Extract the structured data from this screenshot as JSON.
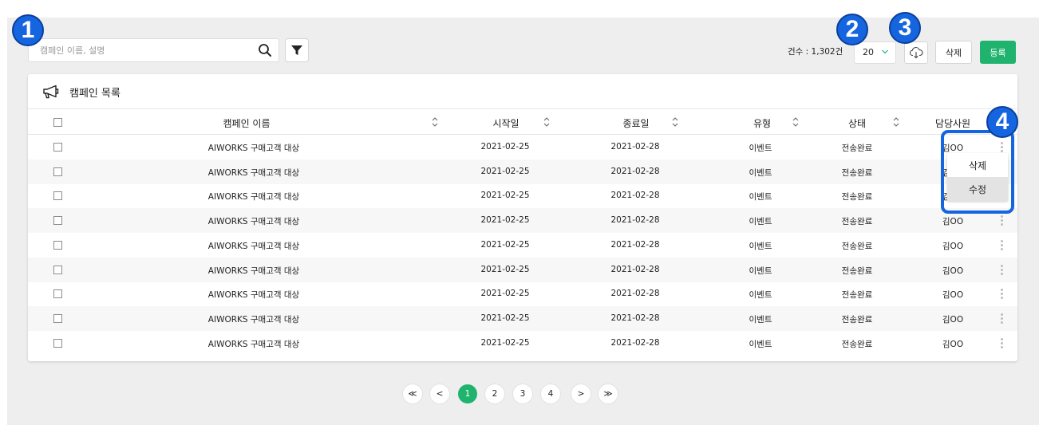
{
  "search": {
    "placeholder": "캠페인 이름, 설명"
  },
  "toolbar": {
    "count_text": "건수 : 1,302건",
    "page_size": "20",
    "delete_label": "삭제",
    "register_label": "등록"
  },
  "badges": [
    "1",
    "2",
    "3",
    "4"
  ],
  "card": {
    "title": "캠페인 목록"
  },
  "table": {
    "columns": [
      "캠페인 이름",
      "시작일",
      "종료일",
      "유형",
      "상태",
      "담당사원"
    ],
    "rows": [
      {
        "name": "AIWORKS 구매고객 대상",
        "start": "2021-02-25",
        "end": "2021-02-28",
        "type": "이벤트",
        "status": "전송완료",
        "owner": "김OO"
      },
      {
        "name": "AIWORKS 구매고객 대상",
        "start": "2021-02-25",
        "end": "2021-02-28",
        "type": "이벤트",
        "status": "전송완료",
        "owner": "김OO"
      },
      {
        "name": "AIWORKS 구매고객 대상",
        "start": "2021-02-25",
        "end": "2021-02-28",
        "type": "이벤트",
        "status": "전송완료",
        "owner": "김OO"
      },
      {
        "name": "AIWORKS 구매고객 대상",
        "start": "2021-02-25",
        "end": "2021-02-28",
        "type": "이벤트",
        "status": "전송완료",
        "owner": "김OO"
      },
      {
        "name": "AIWORKS 구매고객 대상",
        "start": "2021-02-25",
        "end": "2021-02-28",
        "type": "이벤트",
        "status": "전송완료",
        "owner": "김OO"
      },
      {
        "name": "AIWORKS 구매고객 대상",
        "start": "2021-02-25",
        "end": "2021-02-28",
        "type": "이벤트",
        "status": "전송완료",
        "owner": "김OO"
      },
      {
        "name": "AIWORKS 구매고객 대상",
        "start": "2021-02-25",
        "end": "2021-02-28",
        "type": "이벤트",
        "status": "전송완료",
        "owner": "김OO"
      },
      {
        "name": "AIWORKS 구매고객 대상",
        "start": "2021-02-25",
        "end": "2021-02-28",
        "type": "이벤트",
        "status": "전송완료",
        "owner": "김OO"
      },
      {
        "name": "AIWORKS 구매고객 대상",
        "start": "2021-02-25",
        "end": "2021-02-28",
        "type": "이벤트",
        "status": "전송완료",
        "owner": "김OO"
      }
    ]
  },
  "context_menu": {
    "items": [
      "삭제",
      "수정"
    ],
    "highlighted": "수정"
  },
  "pagination": {
    "first": "≪",
    "prev": "<",
    "pages": [
      "1",
      "2",
      "3",
      "4"
    ],
    "current": "1",
    "next": ">",
    "last": "≫"
  },
  "colors": {
    "accent_green": "#1fb36e",
    "badge_blue": "#1565e0",
    "background": "#eeeeee"
  }
}
